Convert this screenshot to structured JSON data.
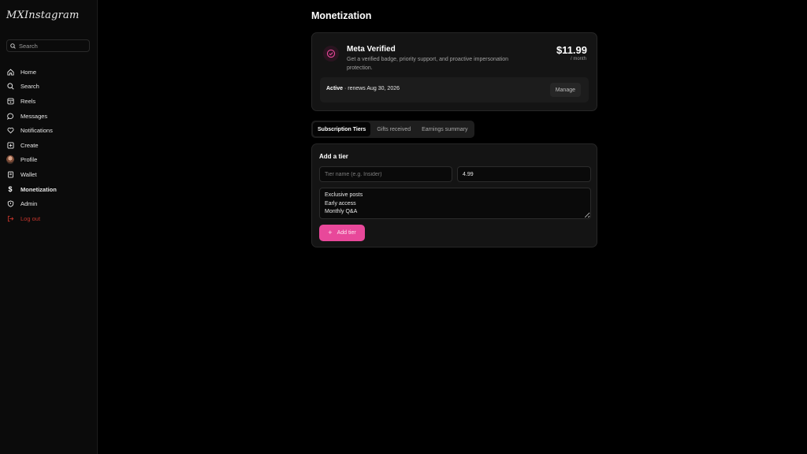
{
  "app": {
    "logo": "MXInstagram"
  },
  "sidebar": {
    "search_placeholder": "Search",
    "items": [
      {
        "label": "Home",
        "icon": "home-icon"
      },
      {
        "label": "Search",
        "icon": "search-icon"
      },
      {
        "label": "Reels",
        "icon": "reels-icon"
      },
      {
        "label": "Messages",
        "icon": "message-icon"
      },
      {
        "label": "Notifications",
        "icon": "heart-icon"
      },
      {
        "label": "Create",
        "icon": "plus-square-icon"
      },
      {
        "label": "Profile",
        "icon": "avatar"
      },
      {
        "label": "Wallet",
        "icon": "wallet-icon"
      },
      {
        "label": "Monetization",
        "icon": "dollar-icon",
        "active": true
      },
      {
        "label": "Admin",
        "icon": "shield-icon"
      },
      {
        "label": "Log out",
        "icon": "logout-icon"
      }
    ]
  },
  "page": {
    "title": "Monetization"
  },
  "verified": {
    "title": "Meta Verified",
    "description": "Get a verified badge, priority support, and proactive impersonation protection.",
    "price": "$11.99",
    "period": "/ month",
    "status_label": "Active",
    "status_detail": " · renews Aug 30, 2026",
    "manage_label": "Manage",
    "accent": "#e8489a"
  },
  "tabs": [
    {
      "label": "Subscription Tiers",
      "active": true
    },
    {
      "label": "Gifts received",
      "active": false
    },
    {
      "label": "Earnings summary",
      "active": false
    }
  ],
  "tier_form": {
    "heading": "Add a tier",
    "name_placeholder": "Tier name (e.g. Insider)",
    "name_value": "",
    "price_value": "4.99",
    "perks_value": "Exclusive posts\nEarly access\nMonthly Q&A",
    "add_label": "Add tier"
  }
}
